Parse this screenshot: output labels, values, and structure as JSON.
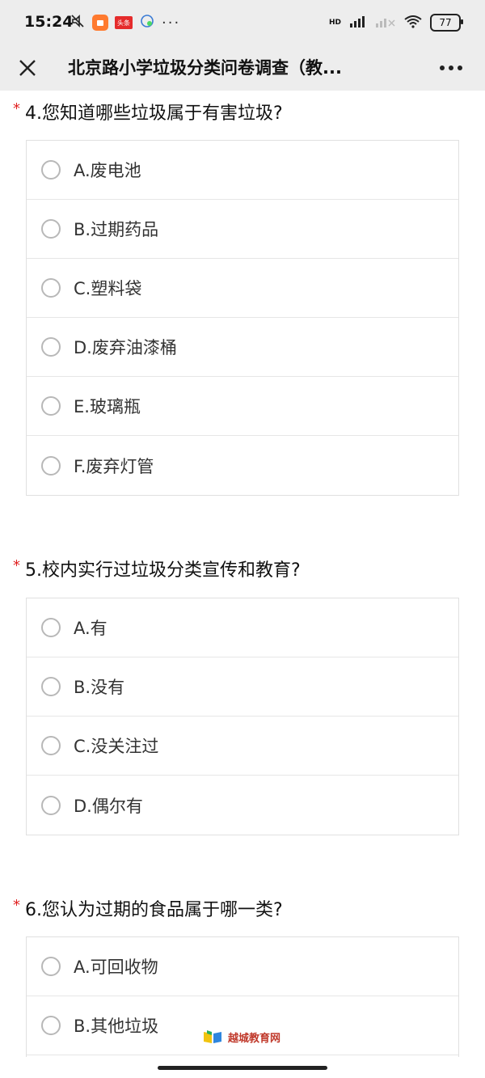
{
  "status_bar": {
    "time": "15:24",
    "app_badge_2": "头条",
    "battery": "77",
    "net_label": "HD"
  },
  "nav": {
    "title": "北京路小学垃圾分类问卷调查（教..."
  },
  "questions": [
    {
      "required_mark": "*",
      "title": "4.您知道哪些垃圾属于有害垃圾?",
      "options": [
        "A.废电池",
        "B.过期药品",
        "C.塑料袋",
        "D.废弃油漆桶",
        "E.玻璃瓶",
        "F.废弃灯管"
      ]
    },
    {
      "required_mark": "*",
      "title": "5.校内实行过垃圾分类宣传和教育?",
      "options": [
        "A.有",
        "B.没有",
        "C.没关注过",
        "D.偶尔有"
      ]
    },
    {
      "required_mark": "*",
      "title": "6.您认为过期的食品属于哪一类?",
      "options": [
        "A.可回收物",
        "B.其他垃圾"
      ]
    }
  ],
  "watermark": {
    "text": "越城教育网"
  }
}
